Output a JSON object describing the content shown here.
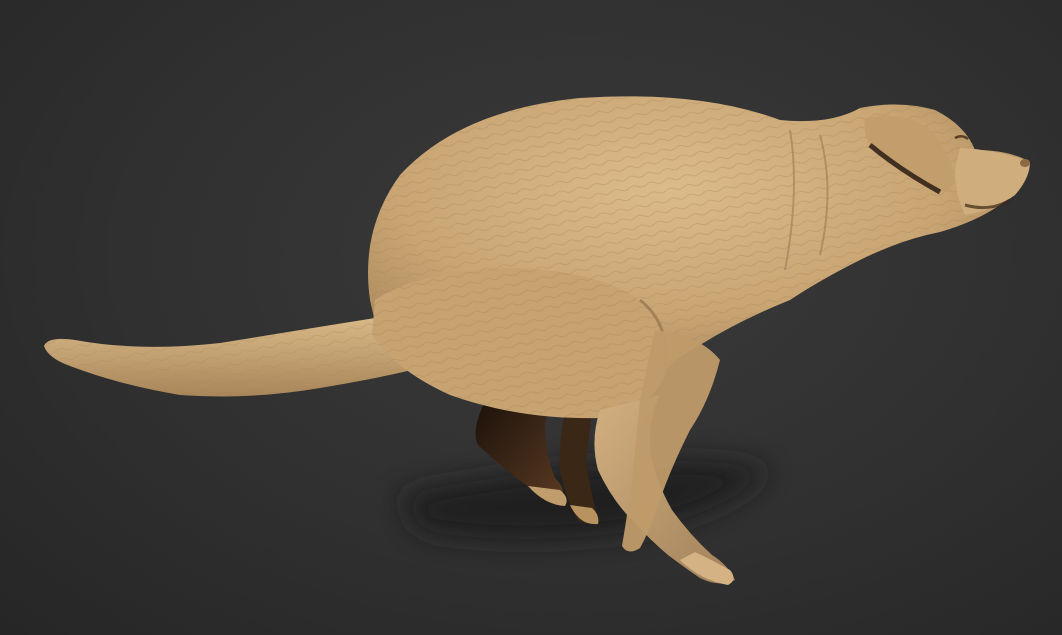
{
  "scene": {
    "subject": "dog-sculpt-render",
    "colors": {
      "background": "#303030",
      "clay": "#c9a574",
      "clay_light": "#dcbb8b",
      "clay_shadow": "#8e6d45",
      "deep_shadow": "#2a1c12",
      "ground_shadow": "#1e1e1e"
    }
  }
}
